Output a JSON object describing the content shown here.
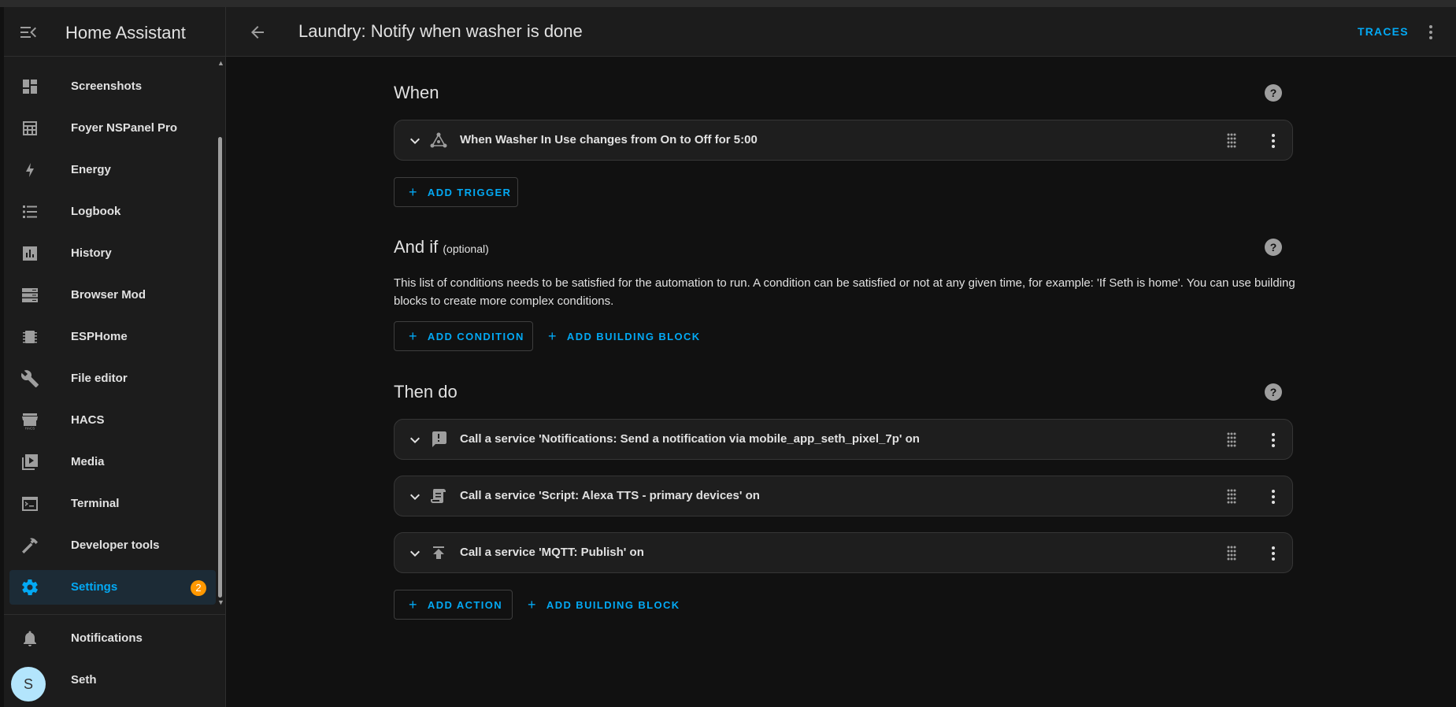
{
  "app": {
    "title": "Home Assistant"
  },
  "sidebar": {
    "items": [
      {
        "label": "Screenshots",
        "icon": "dashboard-icon"
      },
      {
        "label": "Foyer NSPanel Pro",
        "icon": "calculator-grid-icon"
      },
      {
        "label": "Energy",
        "icon": "lightning-icon"
      },
      {
        "label": "Logbook",
        "icon": "list-icon"
      },
      {
        "label": "History",
        "icon": "bar-chart-icon"
      },
      {
        "label": "Browser Mod",
        "icon": "server-icon"
      },
      {
        "label": "ESPHome",
        "icon": "chip-icon"
      },
      {
        "label": "File editor",
        "icon": "wrench-icon"
      },
      {
        "label": "HACS",
        "icon": "store-icon"
      },
      {
        "label": "Media",
        "icon": "play-box-icon"
      },
      {
        "label": "Terminal",
        "icon": "console-icon"
      },
      {
        "label": "Developer tools",
        "icon": "hammer-icon"
      },
      {
        "label": "Settings",
        "icon": "gear-icon",
        "active": true,
        "badge": "2"
      }
    ],
    "notifications_label": "Notifications",
    "user": {
      "initial": "S",
      "name": "Seth"
    }
  },
  "header": {
    "title": "Laundry: Notify when washer is done",
    "traces_label": "TRACES"
  },
  "when": {
    "title": "When",
    "triggers": [
      {
        "label": "When Washer In Use changes from On to Off for 5:00"
      }
    ],
    "add_trigger_label": "ADD TRIGGER"
  },
  "andif": {
    "title": "And if",
    "optional": "(optional)",
    "description": "This list of conditions needs to be satisfied for the automation to run. A condition can be satisfied or not at any given time, for example: 'If Seth is home'. You can use building blocks to create more complex conditions.",
    "add_condition_label": "ADD CONDITION",
    "add_building_block_label": "ADD BUILDING BLOCK"
  },
  "thendo": {
    "title": "Then do",
    "actions": [
      {
        "label": "Call a service 'Notifications: Send a notification via mobile_app_seth_pixel_7p' on"
      },
      {
        "label": "Call a service 'Script: Alexa TTS - primary devices' on"
      },
      {
        "label": "Call a service 'MQTT: Publish' on"
      }
    ],
    "add_action_label": "ADD ACTION",
    "add_building_block_label": "ADD BUILDING BLOCK"
  },
  "colors": {
    "accent": "#03a9f4",
    "badge": "#ff9800",
    "background": "#111111",
    "card": "#1c1c1c"
  }
}
